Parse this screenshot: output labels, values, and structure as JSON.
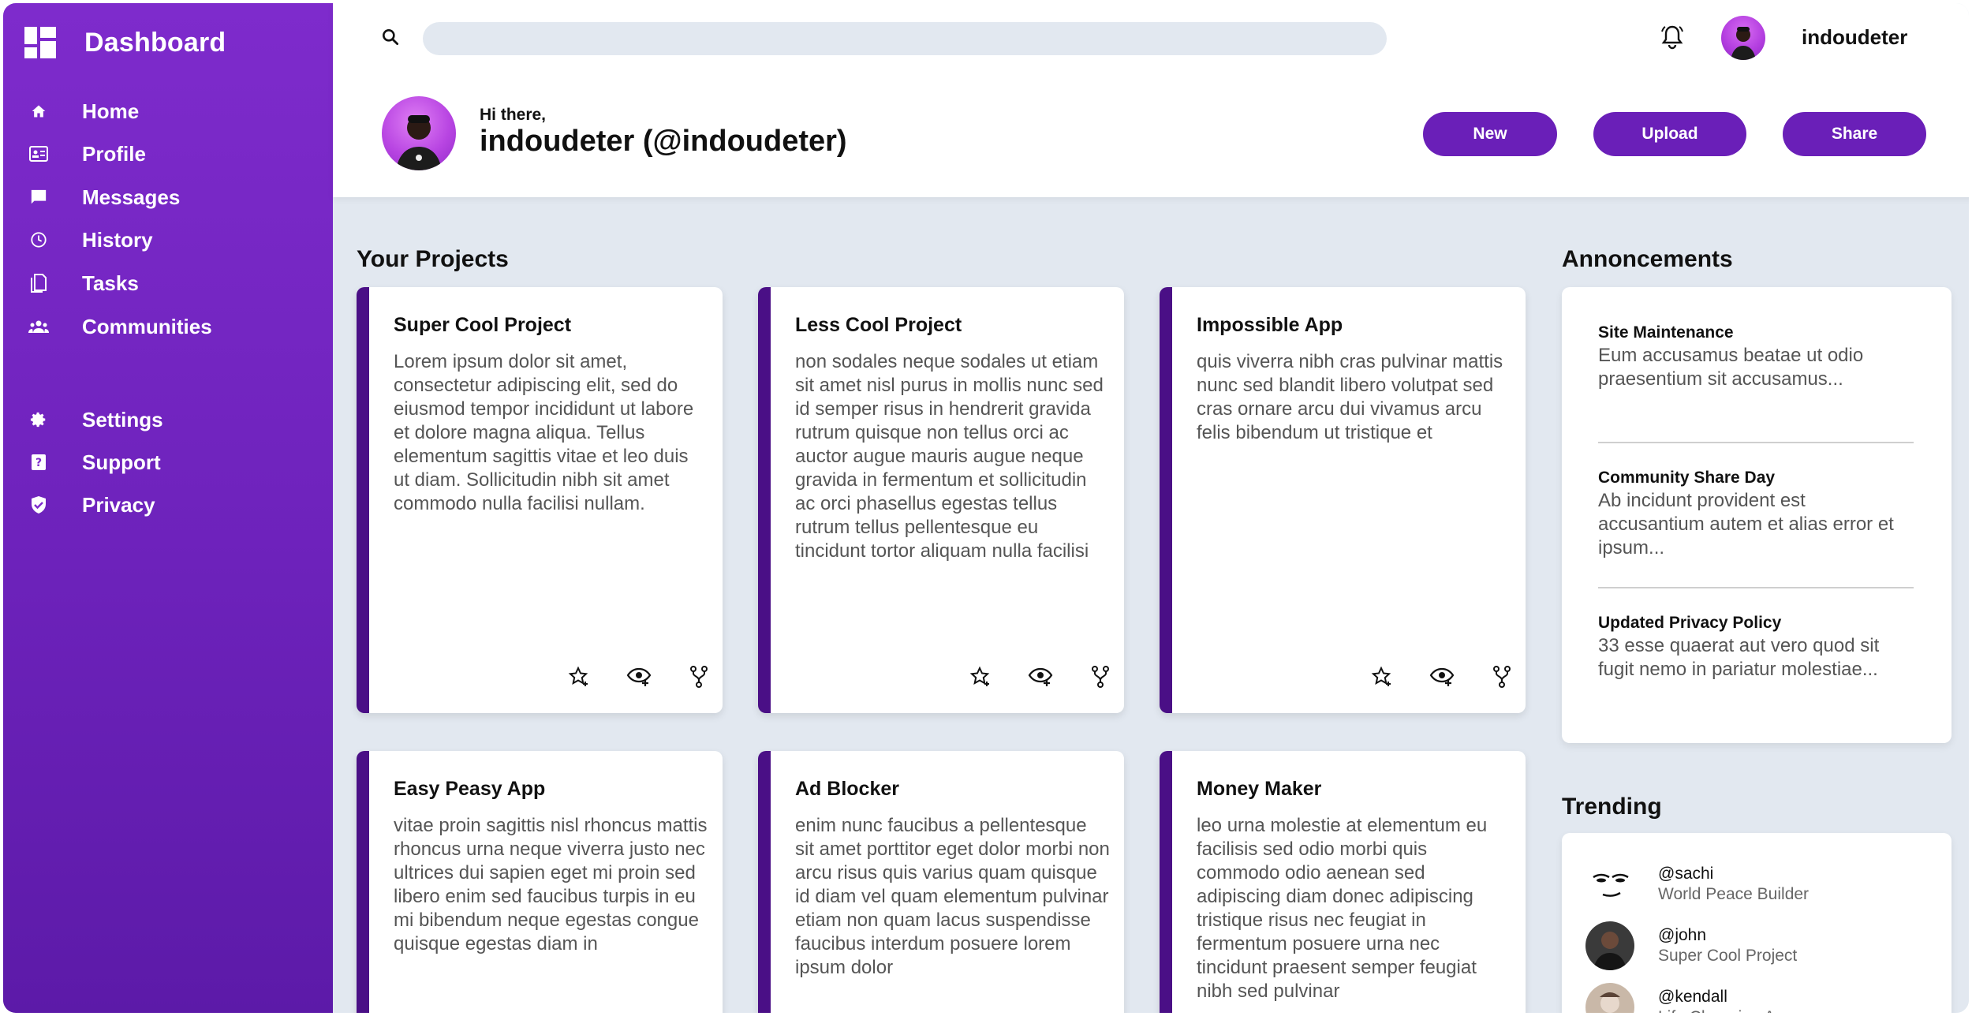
{
  "app": {
    "title": "Dashboard"
  },
  "sidebar": {
    "items": [
      {
        "label": "Home",
        "icon": "home-icon"
      },
      {
        "label": "Profile",
        "icon": "id-card-icon"
      },
      {
        "label": "Messages",
        "icon": "chat-icon"
      },
      {
        "label": "History",
        "icon": "clock-icon"
      },
      {
        "label": "Tasks",
        "icon": "document-icon"
      },
      {
        "label": "Communities",
        "icon": "people-icon"
      }
    ],
    "bottom_items": [
      {
        "label": "Settings",
        "icon": "gear-icon"
      },
      {
        "label": "Support",
        "icon": "help-icon"
      },
      {
        "label": "Privacy",
        "icon": "shield-icon"
      }
    ]
  },
  "topbar": {
    "search_placeholder": "",
    "username": "indoudeter"
  },
  "header": {
    "greeting": "Hi there,",
    "name": "indoudeter (@indoudeter)",
    "buttons": {
      "new": "New",
      "upload": "Upload",
      "share": "Share"
    }
  },
  "projects": {
    "title": "Your Projects",
    "cards": [
      {
        "title": "Super Cool Project",
        "text": "Lorem ipsum dolor sit amet, consectetur adipiscing elit, sed do eiusmod tempor incididunt ut labore et dolore magna aliqua. Tellus elementum sagittis vitae et leo duis ut diam. Sollicitudin nibh sit amet commodo nulla facilisi nullam."
      },
      {
        "title": "Less Cool Project",
        "text": "non sodales neque sodales ut etiam sit amet nisl purus in mollis nunc sed id semper risus in hendrerit gravida rutrum quisque non tellus orci ac auctor augue mauris augue neque gravida in fermentum et sollicitudin ac orci phasellus egestas tellus rutrum tellus pellentesque eu tincidunt tortor aliquam nulla facilisi"
      },
      {
        "title": "Impossible App",
        "text": "quis viverra nibh cras pulvinar mattis nunc sed blandit libero volutpat sed cras ornare arcu dui vivamus arcu felis bibendum ut tristique et"
      },
      {
        "title": "Easy Peasy App",
        "text": "vitae proin sagittis nisl rhoncus mattis rhoncus urna neque viverra justo nec ultrices dui sapien eget mi proin sed libero enim sed faucibus turpis in eu mi bibendum neque egestas congue quisque egestas diam in"
      },
      {
        "title": "Ad Blocker",
        "text": "enim nunc faucibus a pellentesque sit amet porttitor eget dolor morbi non arcu risus quis varius quam quisque id diam vel quam elementum pulvinar etiam non quam lacus suspendisse faucibus interdum posuere lorem ipsum dolor"
      },
      {
        "title": "Money Maker",
        "text": "leo urna molestie at elementum eu facilisis sed odio morbi quis commodo odio aenean sed adipiscing diam donec adipiscing tristique risus nec feugiat in fermentum posuere urna nec tincidunt praesent semper feugiat nibh sed pulvinar"
      }
    ]
  },
  "announcements": {
    "title": "Annoncements",
    "items": [
      {
        "title": "Site Maintenance",
        "body": "Eum accusamus beatae ut odio praesentium sit accusamus..."
      },
      {
        "title": "Community Share Day",
        "body": "Ab incidunt provident est accusantium autem et alias error et ipsum..."
      },
      {
        "title": "Updated Privacy Policy",
        "body": "33 esse quaerat aut vero quod sit fugit nemo in pariatur molestiae..."
      }
    ]
  },
  "trending": {
    "title": "Trending",
    "items": [
      {
        "handle": "@sachi",
        "project": "World Peace Builder"
      },
      {
        "handle": "@john",
        "project": "Super Cool Project"
      },
      {
        "handle": "@kendall",
        "project": "Life Changing App"
      }
    ]
  },
  "colors": {
    "sidebar": "#7e2bcc",
    "accent": "#6a1fb8",
    "card_stripe": "#4a0f86",
    "background": "#e2e8f0"
  }
}
